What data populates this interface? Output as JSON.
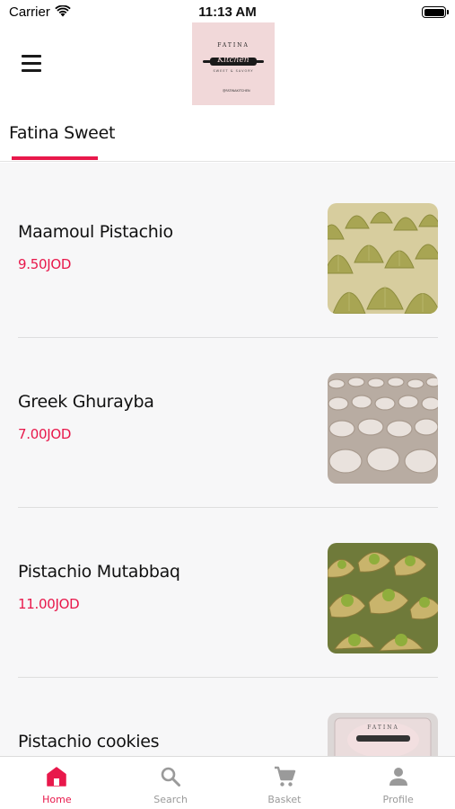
{
  "status_bar": {
    "carrier": "Carrier",
    "time": "11:13 AM"
  },
  "header": {
    "logo": {
      "top_text": "FATINA",
      "script_text": "Kitchen",
      "sub_text": "SWEET & SAVORY",
      "handle_text": "@FATINAKITCHEN"
    }
  },
  "tabs": [
    {
      "label": "Fatina Sweet",
      "active": true
    }
  ],
  "accent_color": "#e8184b",
  "items": [
    {
      "name": "Maamoul Pistachio",
      "price": "9.50JOD",
      "image": "maamoul-photo"
    },
    {
      "name": "Greek Ghurayba",
      "price": "7.00JOD",
      "image": "ghurayba-photo"
    },
    {
      "name": "Pistachio Mutabbaq",
      "price": "11.00JOD",
      "image": "mutabbaq-photo"
    },
    {
      "name": "Pistachio cookies",
      "price": "",
      "image": "cookies-box-photo"
    }
  ],
  "bottom_nav": [
    {
      "label": "Home",
      "icon": "home-icon",
      "active": true
    },
    {
      "label": "Search",
      "icon": "search-icon",
      "active": false
    },
    {
      "label": "Basket",
      "icon": "cart-icon",
      "active": false
    },
    {
      "label": "Profile",
      "icon": "person-icon",
      "active": false
    }
  ]
}
